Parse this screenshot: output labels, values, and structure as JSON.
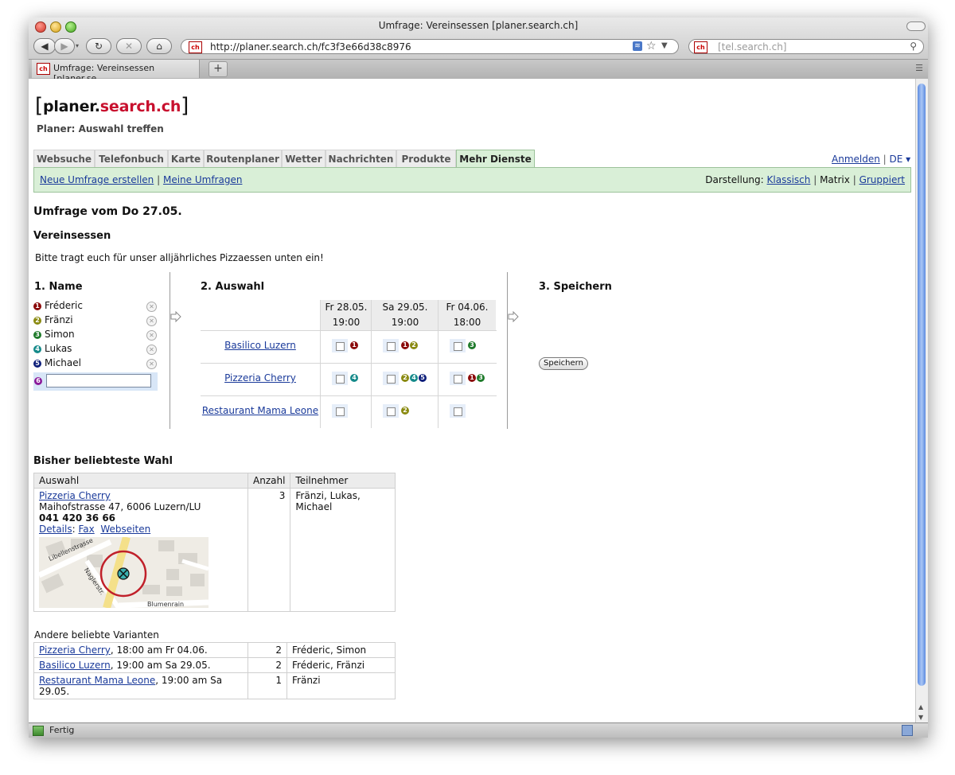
{
  "browser": {
    "window_title": "Umfrage: Vereinsessen [planer.search.ch]",
    "url": "http://planer.search.ch/fc3f3e66d38c8976",
    "search_placeholder": "[tel.search.ch]",
    "tab_label": "Umfrage: Vereinsessen [planer.se...",
    "new_tab": "+",
    "status": "Fertig",
    "favicon": "ch"
  },
  "site": {
    "logo_left": "planer.",
    "logo_right": "search.ch",
    "subtitle": "Planer: Auswahl treffen",
    "nav": [
      "Websuche",
      "Telefonbuch",
      "Karte",
      "Routenplaner",
      "Wetter",
      "Nachrichten",
      "Produkte",
      "Mehr Dienste ▾"
    ],
    "login": "Anmelden",
    "lang": "DE ▾",
    "sep": "|",
    "sub_links": [
      "Neue Umfrage erstellen",
      "Meine Umfragen"
    ],
    "darstellung_label": "Darstellung:",
    "darstellung_options": [
      "Klassisch",
      "Matrix",
      "Gruppiert"
    ]
  },
  "poll": {
    "heading": "Umfrage vom Do 27.05.",
    "title": "Vereinsessen",
    "description": "Bitte tragt euch für unser alljährliches Pizzaessen unten ein!",
    "step1": "1. Name",
    "step2": "2. Auswahl",
    "step3": "3. Speichern",
    "save_button": "Speichern",
    "participants": [
      {
        "num": "1",
        "name": "Fréderic",
        "color": "#8b0a0a"
      },
      {
        "num": "2",
        "name": "Fränzi",
        "color": "#8a8a10"
      },
      {
        "num": "3",
        "name": "Simon",
        "color": "#1e7a2a"
      },
      {
        "num": "4",
        "name": "Lukas",
        "color": "#158a8a"
      },
      {
        "num": "5",
        "name": "Michael",
        "color": "#0d1e7a"
      }
    ],
    "new_participant_num": "6",
    "new_participant_color": "#8a1a9a",
    "dates": [
      {
        "day": "Fr 28.05.",
        "time": "19:00"
      },
      {
        "day": "Sa 29.05.",
        "time": "19:00"
      },
      {
        "day": "Fr 04.06.",
        "time": "18:00"
      }
    ],
    "options": [
      {
        "name": "Basilico Luzern",
        "votes": [
          [
            "1"
          ],
          [
            "1",
            "2"
          ],
          [
            "3"
          ]
        ]
      },
      {
        "name": "Pizzeria Cherry",
        "votes": [
          [
            "4"
          ],
          [
            "2",
            "4",
            "5"
          ],
          [
            "1",
            "3"
          ]
        ]
      },
      {
        "name": "Restaurant Mama Leone",
        "votes": [
          [],
          [
            "2"
          ],
          []
        ]
      }
    ]
  },
  "results": {
    "heading": "Bisher beliebteste Wahl",
    "col_choice": "Auswahl",
    "col_count": "Anzahl",
    "col_participants": "Teilnehmer",
    "top": {
      "name": "Pizzeria Cherry",
      "address": "Maihofstrasse 47, 6006 Luzern/LU",
      "phone": "041 420 36 66",
      "links": [
        "Details",
        "Fax",
        "Webseiten"
      ],
      "count": "3",
      "participants": "Fränzi, Lukas, Michael",
      "map_streets": [
        "Libellenstrasse",
        "Naglerstr.",
        "Blumenrain"
      ]
    },
    "others_heading": "Andere beliebte Varianten",
    "others": [
      {
        "name": "Pizzeria Cherry",
        "when": ", 18:00 am Fr 04.06.",
        "count": "2",
        "participants": "Fréderic, Simon"
      },
      {
        "name": "Basilico Luzern",
        "when": ", 19:00 am Sa 29.05.",
        "count": "2",
        "participants": "Fréderic, Fränzi"
      },
      {
        "name": "Restaurant Mama Leone",
        "when": ", 19:00 am Sa 29.05.",
        "count": "1",
        "participants": "Fränzi"
      }
    ]
  }
}
